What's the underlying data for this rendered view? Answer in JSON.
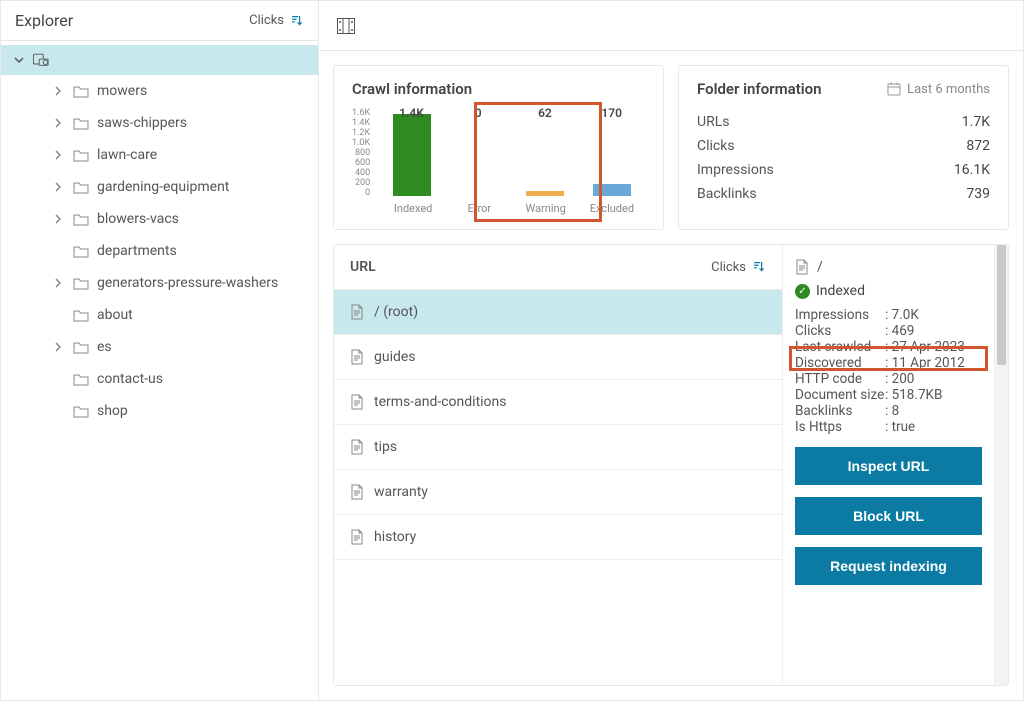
{
  "sidebar": {
    "title": "Explorer",
    "sort_label": "Clicks",
    "items": [
      {
        "label": "mowers",
        "hasChildren": true
      },
      {
        "label": "saws-chippers",
        "hasChildren": true
      },
      {
        "label": "lawn-care",
        "hasChildren": true
      },
      {
        "label": "gardening-equipment",
        "hasChildren": true
      },
      {
        "label": "blowers-vacs",
        "hasChildren": true
      },
      {
        "label": "departments",
        "hasChildren": false
      },
      {
        "label": "generators-pressure-washers",
        "hasChildren": true
      },
      {
        "label": "about",
        "hasChildren": false
      },
      {
        "label": "es",
        "hasChildren": true
      },
      {
        "label": "contact-us",
        "hasChildren": false
      },
      {
        "label": "shop",
        "hasChildren": false
      }
    ]
  },
  "crawl_card": {
    "title": "Crawl information"
  },
  "chart_data": {
    "type": "bar",
    "categories": [
      "Indexed",
      "Error",
      "Warning",
      "Excluded"
    ],
    "values": [
      1400,
      0,
      62,
      170
    ],
    "display_labels": [
      "1.4K",
      "0",
      "62",
      "170"
    ],
    "colors": [
      "#2e8b1f",
      "#d9534f",
      "#f0ad4e",
      "#6aa8d8"
    ],
    "y_ticks": [
      "1.6K",
      "1.4K",
      "1.2K",
      "1.0K",
      "800",
      "600",
      "400",
      "200",
      "0"
    ],
    "ylim": [
      0,
      1600
    ],
    "title": "Crawl information"
  },
  "folder_card": {
    "title": "Folder information",
    "period": "Last 6 months",
    "rows": [
      {
        "k": "URLs",
        "v": "1.7K"
      },
      {
        "k": "Clicks",
        "v": "872"
      },
      {
        "k": "Impressions",
        "v": "16.1K"
      },
      {
        "k": "Backlinks",
        "v": "739"
      }
    ]
  },
  "url_panel": {
    "header": "URL",
    "sort_label": "Clicks",
    "rows": [
      {
        "label": "/ (root)",
        "selected": true
      },
      {
        "label": "guides",
        "selected": false
      },
      {
        "label": "terms-and-conditions",
        "selected": false
      },
      {
        "label": "tips",
        "selected": false
      },
      {
        "label": "warranty",
        "selected": false
      },
      {
        "label": "history",
        "selected": false
      }
    ]
  },
  "detail": {
    "path": "/",
    "status": "Indexed",
    "rows": [
      {
        "k": "Impressions",
        "v": "7.0K"
      },
      {
        "k": "Clicks",
        "v": "469"
      },
      {
        "k": "Last crawled",
        "v": "27 Apr 2023",
        "highlight": true
      },
      {
        "k": "Discovered",
        "v": "11 Apr 2012"
      },
      {
        "k": "HTTP code",
        "v": "200"
      },
      {
        "k": "Document size",
        "v": "518.7KB",
        "nocolon": true
      },
      {
        "k": "Backlinks",
        "v": "8"
      },
      {
        "k": "Is Https",
        "v": "true"
      }
    ],
    "buttons": {
      "inspect": "Inspect URL",
      "block": "Block URL",
      "request": "Request indexing"
    }
  }
}
